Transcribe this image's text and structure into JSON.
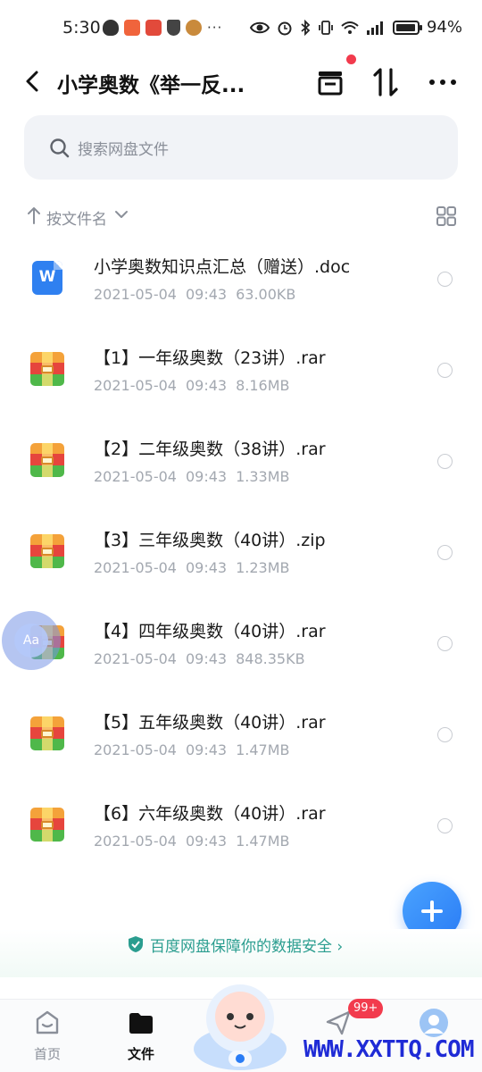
{
  "status_bar": {
    "time": "5:30",
    "more": "···",
    "battery_text": "94%",
    "battery_level": 0.94,
    "network": "5G"
  },
  "header": {
    "title": "小学奥数《举一反..."
  },
  "search": {
    "placeholder": "搜索网盘文件"
  },
  "sort": {
    "label": "按文件名"
  },
  "files": [
    {
      "name": "小学奥数知识点汇总（赠送）.doc",
      "date": "2021-05-04",
      "time": "09:43",
      "size": "63.00KB",
      "type": "doc"
    },
    {
      "name": "【1】一年级奥数（23讲）.rar",
      "date": "2021-05-04",
      "time": "09:43",
      "size": "8.16MB",
      "type": "archive"
    },
    {
      "name": "【2】二年级奥数（38讲）.rar",
      "date": "2021-05-04",
      "time": "09:43",
      "size": "1.33MB",
      "type": "archive"
    },
    {
      "name": "【3】三年级奥数（40讲）.zip",
      "date": "2021-05-04",
      "time": "09:43",
      "size": "1.23MB",
      "type": "archive"
    },
    {
      "name": "【4】四年级奥数（40讲）.rar",
      "date": "2021-05-04",
      "time": "09:43",
      "size": "848.35KB",
      "type": "archive"
    },
    {
      "name": "【5】五年级奥数（40讲）.rar",
      "date": "2021-05-04",
      "time": "09:43",
      "size": "1.47MB",
      "type": "archive"
    },
    {
      "name": "【6】六年级奥数（40讲）.rar",
      "date": "2021-05-04",
      "time": "09:43",
      "size": "1.47MB",
      "type": "archive"
    }
  ],
  "floating": {
    "label": "Aa"
  },
  "safety_banner": {
    "text": "百度网盘保障你的数据安全 ›"
  },
  "bottom_nav": {
    "home": "首页",
    "files": "文件",
    "share_badge": "99+"
  },
  "watermark": "WWW.XXTTQ.COM",
  "colors": {
    "accent": "#2a7cf5",
    "safety": "#2a9d8f",
    "badge": "#f23b4d"
  }
}
